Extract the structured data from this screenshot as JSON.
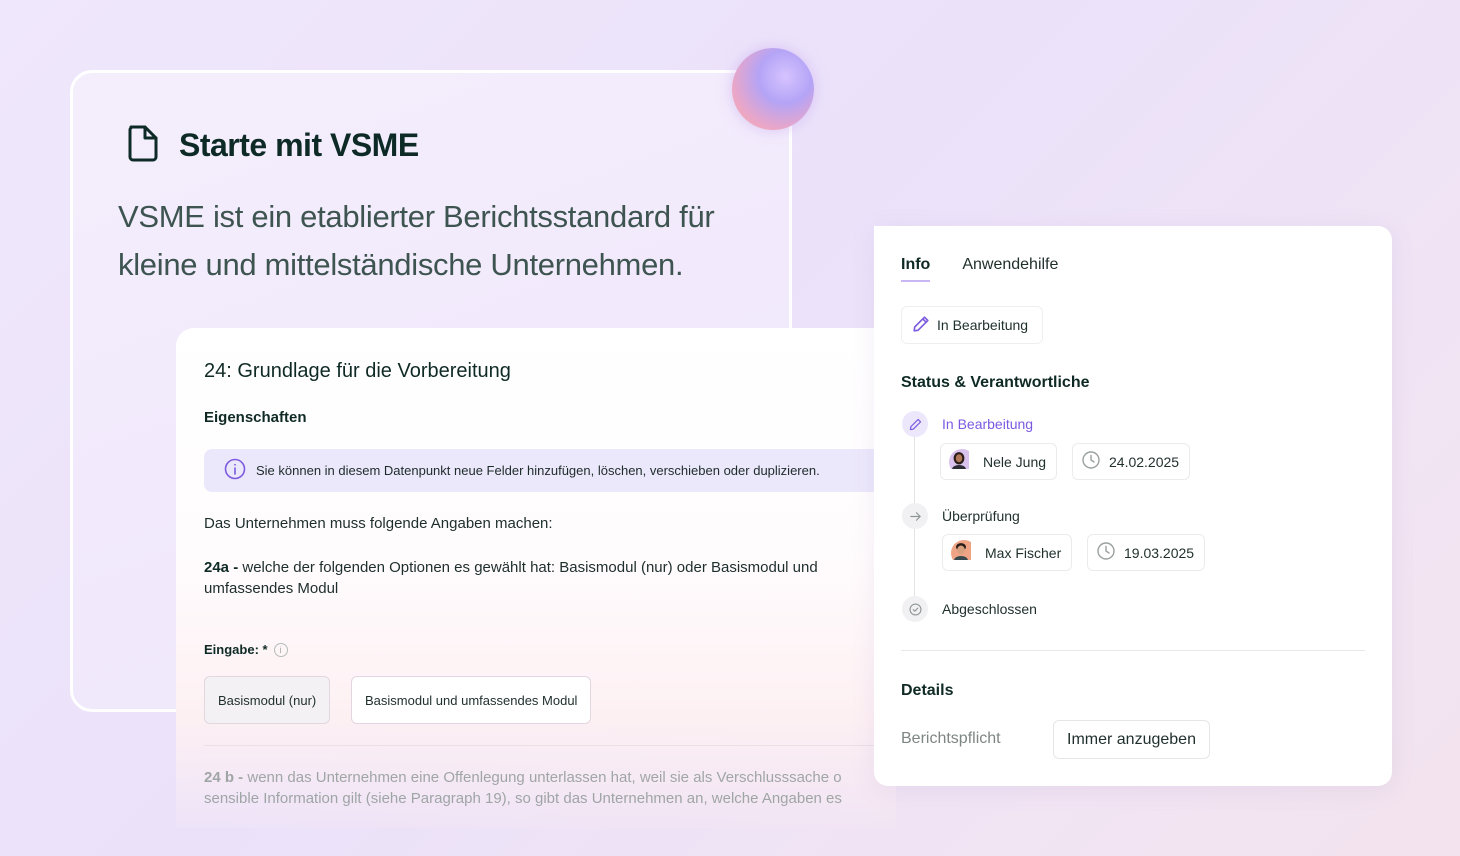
{
  "intro": {
    "title": "Starte mit VSME",
    "description": "VSME ist ein etablierter Berichtsstandard für kleine und mittelständische Unternehmen."
  },
  "datapoint": {
    "title": "24: Grundlage für die Vorbereitung",
    "properties_heading": "Eigenschaften",
    "info_text": "Sie können in diesem Datenpunkt neue Felder hinzufügen, löschen, verschieben oder duplizieren.",
    "requirement_intro": "Das Unternehmen muss folgende Angaben machen:",
    "item_24a": {
      "prefix": "24a -",
      "text": " welche der folgenden Optionen es gewählt hat: Basismodul (nur) oder Basismodul und umfassendes Modul"
    },
    "input_label": "Eingabe: *",
    "input_help": "i",
    "options": [
      "Basismodul (nur)",
      "Basismodul und umfassendes Modul"
    ],
    "item_24b": {
      "prefix": "24 b -",
      "line1": " wenn das Unternehmen eine Offenlegung unterlassen hat, weil sie als Verschlusssache o",
      "line2": "sensible Information gilt (siehe Paragraph 19), so gibt das Unternehmen an, welche Angaben es"
    }
  },
  "panel": {
    "tabs": [
      "Info",
      "Anwendehilfe"
    ],
    "status": "In Bearbeitung",
    "status_section_title": "Status & Verantwortliche",
    "steps": [
      {
        "label": "In Bearbeitung",
        "assignee": "Nele Jung",
        "date": "24.02.2025"
      },
      {
        "label": "Überprüfung",
        "assignee": "Max Fischer",
        "date": "19.03.2025"
      },
      {
        "label": "Abgeschlossen"
      }
    ],
    "details_title": "Details",
    "detail_label": "Berichtspflicht",
    "detail_value": "Immer anzugeben"
  },
  "colors": {
    "accent": "#7b5ae0",
    "info_banner": "#ece8fb",
    "text_dark": "#0f2a25"
  }
}
